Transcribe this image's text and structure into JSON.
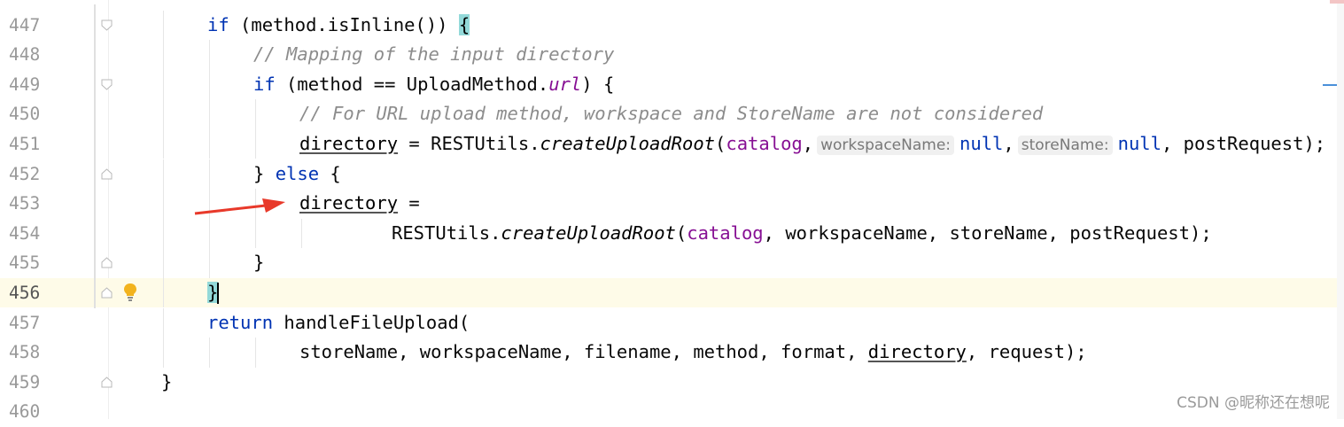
{
  "editor": {
    "first_line_number": 447,
    "current_line_index": 9,
    "lines": [
      {
        "num": "447",
        "indent": 2,
        "tokens": [
          [
            "kw",
            "if"
          ],
          [
            "pl",
            " (method.isInline()) "
          ],
          [
            "br",
            "{"
          ]
        ]
      },
      {
        "num": "448",
        "indent": 3,
        "tokens": [
          [
            "cm",
            "// Mapping of the input directory"
          ]
        ]
      },
      {
        "num": "449",
        "indent": 3,
        "tokens": [
          [
            "kw",
            "if"
          ],
          [
            "pl",
            " (method == UploadMethod."
          ],
          [
            "st",
            "url"
          ],
          [
            "pl",
            ") {"
          ]
        ]
      },
      {
        "num": "450",
        "indent": 4,
        "tokens": [
          [
            "cm",
            "// For URL upload method, workspace and StoreName are not considered"
          ]
        ]
      },
      {
        "num": "451",
        "indent": 4,
        "tokens": [
          [
            "u",
            "directory"
          ],
          [
            "pl",
            " = RESTUtils."
          ],
          [
            "fn",
            "createUploadRoot"
          ],
          [
            "pl",
            "("
          ],
          [
            "pr",
            "catalog"
          ],
          [
            "pl",
            ","
          ],
          [
            "hint",
            "workspaceName:"
          ],
          [
            "kw",
            "null"
          ],
          [
            "pl",
            ","
          ],
          [
            "hint",
            "storeName:"
          ],
          [
            "kw",
            "null"
          ],
          [
            "pl",
            ", postRequest);"
          ]
        ]
      },
      {
        "num": "452",
        "indent": 3,
        "tokens": [
          [
            "pl",
            "} "
          ],
          [
            "kw",
            "else"
          ],
          [
            "pl",
            " {"
          ]
        ]
      },
      {
        "num": "453",
        "indent": 4,
        "tokens": [
          [
            "u",
            "directory"
          ],
          [
            "pl",
            " ="
          ]
        ]
      },
      {
        "num": "454",
        "indent": 6,
        "tokens": [
          [
            "pl",
            "RESTUtils."
          ],
          [
            "fn",
            "createUploadRoot"
          ],
          [
            "pl",
            "("
          ],
          [
            "pr",
            "catalog"
          ],
          [
            "pl",
            ", workspaceName, storeName, postRequest);"
          ]
        ]
      },
      {
        "num": "455",
        "indent": 3,
        "tokens": [
          [
            "pl",
            "}"
          ]
        ]
      },
      {
        "num": "456",
        "indent": 2,
        "tokens": [
          [
            "br",
            "}"
          ],
          [
            "caret",
            ""
          ]
        ]
      },
      {
        "num": "457",
        "indent": 2,
        "tokens": [
          [
            "kw",
            "return"
          ],
          [
            "pl",
            " handleFileUpload("
          ]
        ]
      },
      {
        "num": "458",
        "indent": 4,
        "tokens": [
          [
            "pl",
            "storeName, workspaceName, filename, method, format, "
          ],
          [
            "u",
            "directory"
          ],
          [
            "pl",
            ", request);"
          ]
        ]
      },
      {
        "num": "459",
        "indent": 1,
        "tokens": [
          [
            "pl",
            "}"
          ]
        ]
      },
      {
        "num": "460",
        "indent": 0,
        "tokens": []
      }
    ]
  },
  "gutter_icons": {
    "0": "fold-open-icon",
    "2": "fold-open-icon",
    "5": "fold-close-icon",
    "8": "fold-close-icon",
    "9": "fold-close-icon",
    "12": "fold-close-icon"
  },
  "intention_bulb_line": 9,
  "watermark": "CSDN @昵称还在想呢",
  "colors": {
    "keyword": "#0033b3",
    "comment": "#8c8c8c",
    "static_field": "#871094",
    "brace_match": "#93d9d9",
    "current_line": "#fefbe8",
    "arrow": "#e8392a"
  }
}
